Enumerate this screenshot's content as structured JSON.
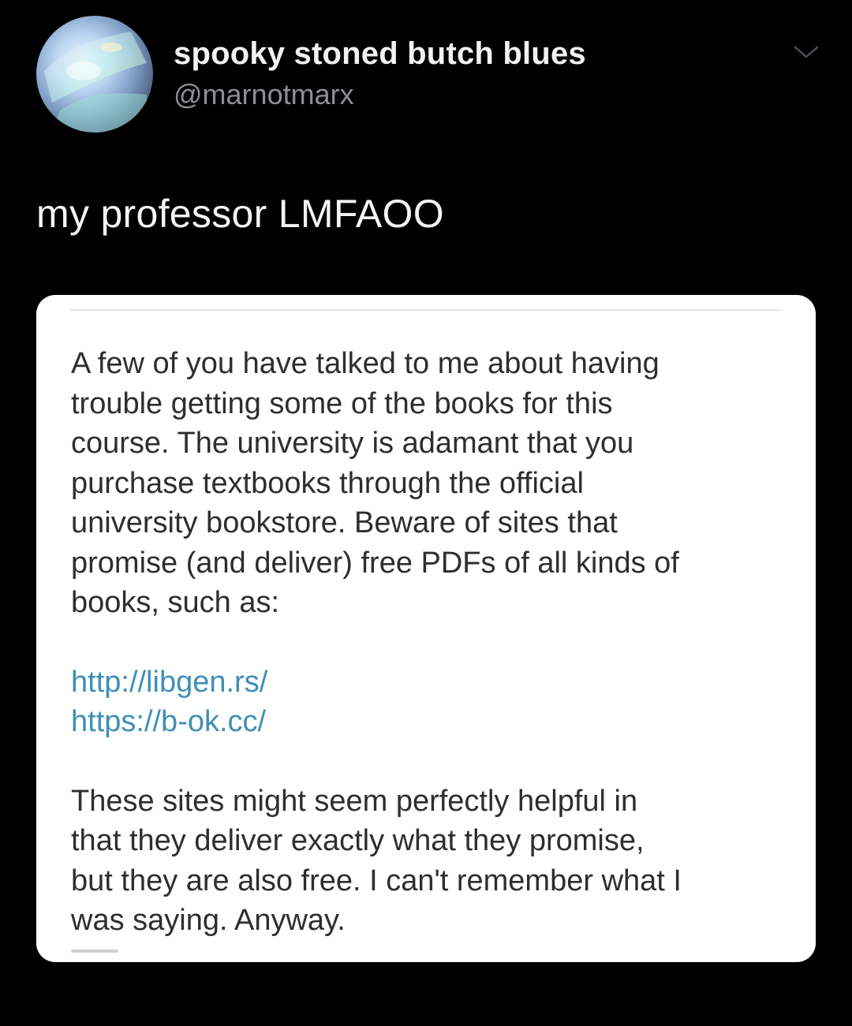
{
  "tweet": {
    "author": {
      "display_name": "spooky stoned butch blues",
      "handle": "@marnotmarx",
      "avatar_icon": "holographic-avatar"
    },
    "menu_icon": "chevron-down-icon",
    "text": "my professor LMFAOO",
    "colors": {
      "background": "#000000",
      "handle": "#8b8f93",
      "link": "#3f8fb7"
    },
    "attachment": {
      "intro": "A few of you have talked to me about having\ntrouble getting some of the books for this\ncourse. The university is adamant that you\npurchase textbooks through the official\nuniversity bookstore. Beware of sites that\npromise (and deliver) free PDFs of all kinds of\nbooks, such as:",
      "links": [
        "http://libgen.rs/",
        "https://b-ok.cc/"
      ],
      "outro": "These sites might seem perfectly helpful in\nthat they deliver exactly what they promise,\nbut they are also free. I can't remember what I\nwas saying. Anyway."
    }
  }
}
